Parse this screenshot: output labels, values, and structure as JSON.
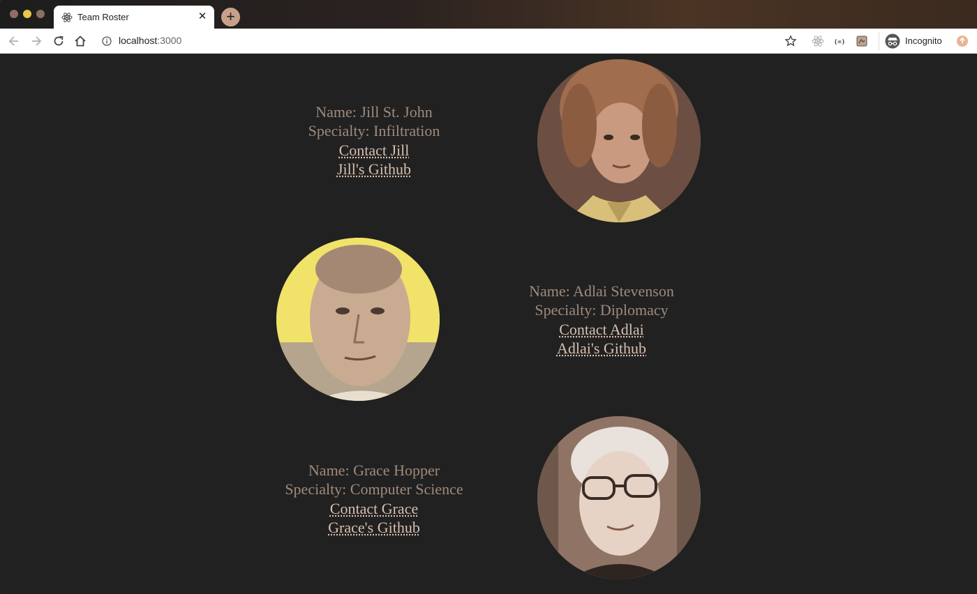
{
  "browser": {
    "tab_title": "Team Roster",
    "url_host": "localhost",
    "url_port": ":3000",
    "incognito_label": "Incognito",
    "accent": "#c8a08a"
  },
  "members": [
    {
      "name_line": "Name: Jill St. John",
      "specialty_line": "Specialty: Infiltration",
      "contact_label": "Contact Jill",
      "github_label": "Jill's Github",
      "photo_bg": "#7b5a4a"
    },
    {
      "name_line": "Name: Adlai Stevenson",
      "specialty_line": "Specialty: Diplomacy",
      "contact_label": "Contact Adlai",
      "github_label": "Adlai's Github",
      "photo_bg": "#f1e26a"
    },
    {
      "name_line": "Name: Grace Hopper",
      "specialty_line": "Specialty: Computer Science",
      "contact_label": "Contact Grace",
      "github_label": "Grace's Github",
      "photo_bg": "#a88b7c"
    }
  ],
  "colors": {
    "page_bg": "#212121",
    "text": "#a08a7c",
    "link": "#d9bfae"
  }
}
